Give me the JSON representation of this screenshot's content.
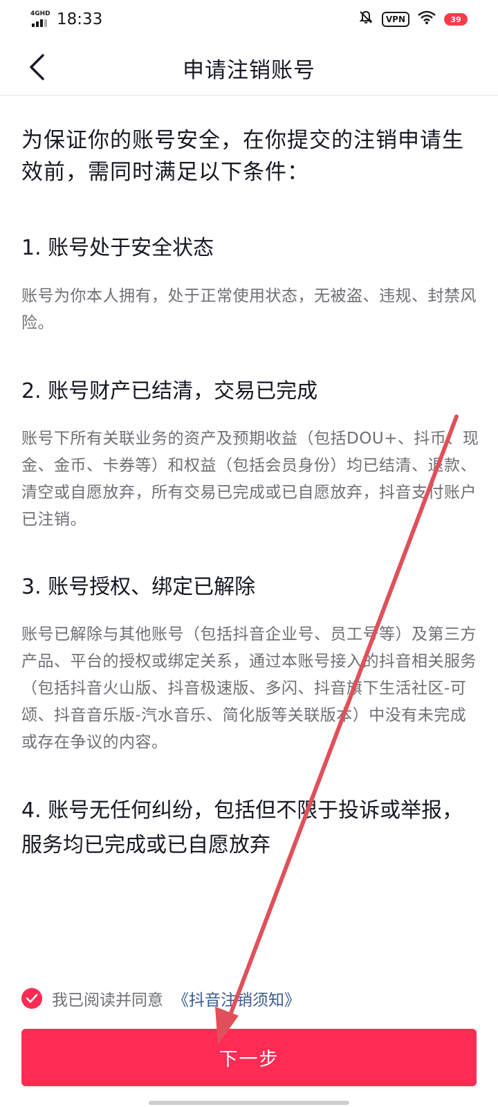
{
  "status_bar": {
    "network": "4GHD",
    "time": "18:33",
    "vpn": "VPN",
    "battery": "39"
  },
  "header": {
    "title": "申请注销账号"
  },
  "content": {
    "intro": "为保证你的账号安全，在你提交的注销申请生效前，需同时满足以下条件：",
    "conditions": [
      {
        "title": "1. 账号处于安全状态",
        "desc": "账号为你本人拥有，处于正常使用状态，无被盗、违规、封禁风险。"
      },
      {
        "title": "2. 账号财产已结清，交易已完成",
        "desc": "账号下所有关联业务的资产及预期收益（包括DOU+、抖币、现金、金币、卡券等）和权益（包括会员身份）均已结清、退款、清空或自愿放弃，所有交易已完成或已自愿放弃，抖音支付账户已注销。"
      },
      {
        "title": "3. 账号授权、绑定已解除",
        "desc": "账号已解除与其他账号（包括抖音企业号、员工号等）及第三方产品、平台的授权或绑定关系，通过本账号接入的抖音相关服务（包括抖音火山版、抖音极速版、多闪、抖音旗下生活社区-可颂、抖音音乐版-汽水音乐、简化版等关联版本）中没有未完成或存在争议的内容。"
      },
      {
        "title": "4. 账号无任何纠纷，包括但不限于投诉或举报，服务均已完成或已自愿放弃"
      }
    ]
  },
  "agreement": {
    "checked": true,
    "text": "我已阅读并同意",
    "link": "《抖音注销须知》"
  },
  "next_button": {
    "label": "下一步"
  },
  "icons": {
    "back": "chevron-left-icon",
    "check": "checkmark-icon",
    "wifi": "wifi-icon",
    "mute": "bell-off-icon"
  },
  "colors": {
    "accent": "#fe2c55",
    "link": "#3a5a8c",
    "annotation": "#e0505a"
  }
}
